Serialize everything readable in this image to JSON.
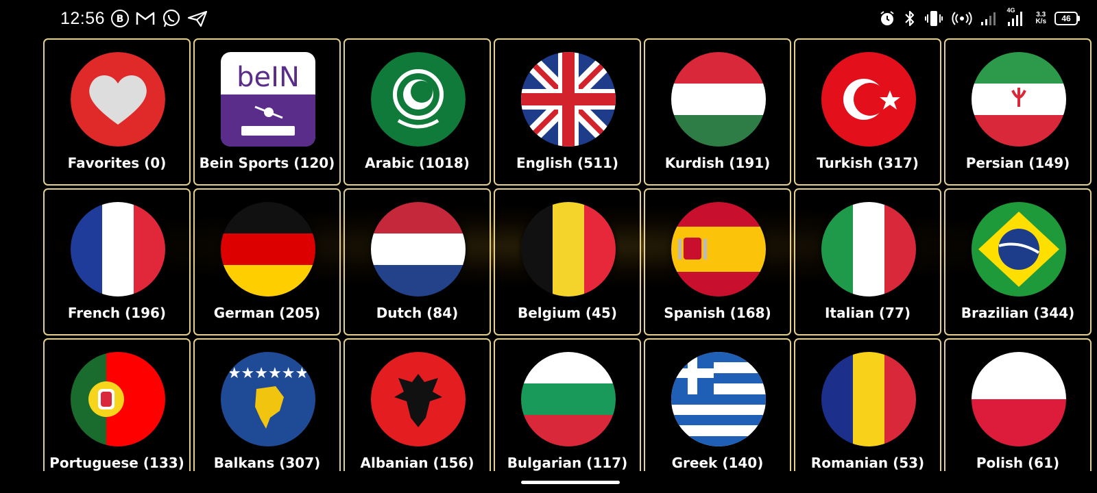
{
  "status_bar": {
    "time": "12:56",
    "notification_icons": [
      "b-circle-icon",
      "gmail-icon",
      "whatsapp-icon",
      "telegram-icon"
    ],
    "system_icons": [
      "alarm-icon",
      "bluetooth-icon",
      "vibrate-icon",
      "hotspot-icon",
      "signal-icon",
      "signal-4g-icon"
    ],
    "network_type": "4G",
    "net_speed_value": "3.3",
    "net_speed_unit": "K/s",
    "battery": "46"
  },
  "categories": [
    {
      "label": "Favorites (0)",
      "icon": "heart-icon"
    },
    {
      "label": "Bein Sports (120)",
      "icon": "bein-logo"
    },
    {
      "label": "Arabic (1018)",
      "icon": "arab-league-flag"
    },
    {
      "label": "English (511)",
      "icon": "uk-flag"
    },
    {
      "label": "Kurdish (191)",
      "icon": "kurdish-flag"
    },
    {
      "label": "Turkish (317)",
      "icon": "turkey-flag"
    },
    {
      "label": "Persian (149)",
      "icon": "iran-flag"
    },
    {
      "label": "French (196)",
      "icon": "france-flag"
    },
    {
      "label": "German (205)",
      "icon": "germany-flag"
    },
    {
      "label": "Dutch (84)",
      "icon": "netherlands-flag"
    },
    {
      "label": "Belgium (45)",
      "icon": "belgium-flag"
    },
    {
      "label": "Spanish (168)",
      "icon": "spain-flag"
    },
    {
      "label": "Italian (77)",
      "icon": "italy-flag"
    },
    {
      "label": "Brazilian (344)",
      "icon": "brazil-flag"
    },
    {
      "label": "Portuguese (133)",
      "icon": "portugal-flag"
    },
    {
      "label": "Balkans (307)",
      "icon": "kosovo-flag"
    },
    {
      "label": "Albanian (156)",
      "icon": "albania-flag"
    },
    {
      "label": "Bulgarian (117)",
      "icon": "bulgaria-flag"
    },
    {
      "label": "Greek (140)",
      "icon": "greece-flag"
    },
    {
      "label": "Romanian (53)",
      "icon": "romania-flag"
    },
    {
      "label": "Polish (61)",
      "icon": "poland-flag"
    }
  ],
  "colors": {
    "tile_border": "#e6d08e",
    "background": "#000000",
    "text": "#ffffff"
  }
}
